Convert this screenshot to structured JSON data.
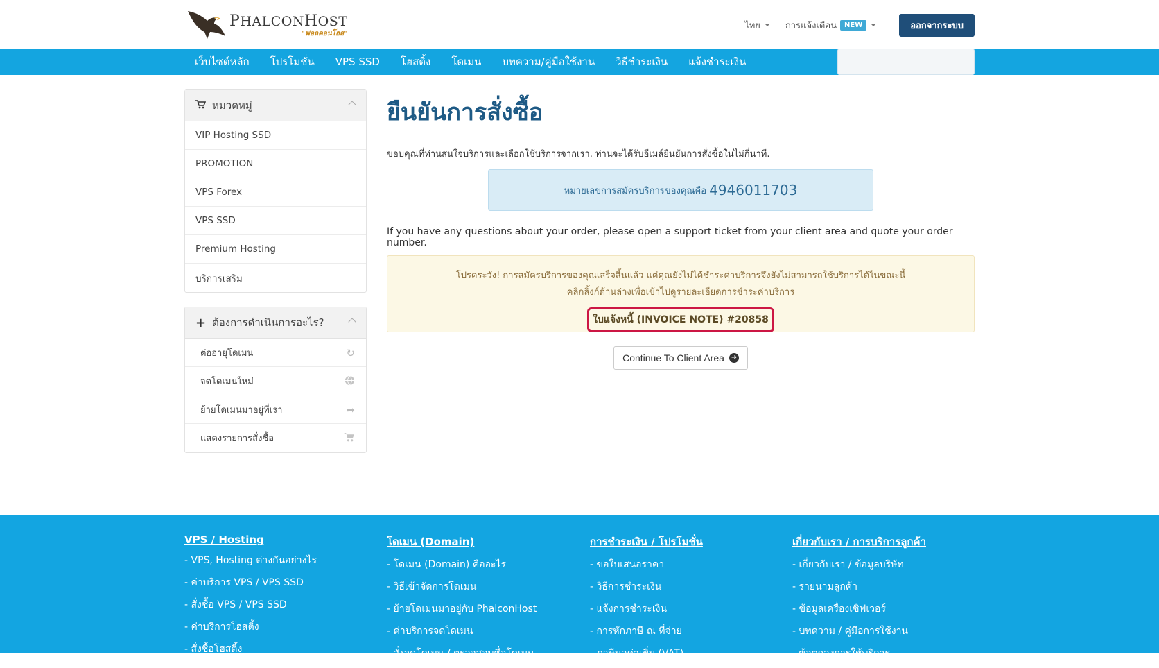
{
  "brand": {
    "name_first": "P",
    "name_rest": "HALCON",
    "name_second": "H",
    "name_second_rest": "OST",
    "tagline": "\"ฟอลคอนโฮส\""
  },
  "header": {
    "language": "ไทย",
    "notifications": "การแจ้งเตือน",
    "new_badge": "NEW",
    "logout": "ออกจากระบบ"
  },
  "nav": {
    "items": [
      "เว็บไซต์หลัก",
      "โปรโมชั่น",
      "VPS SSD",
      "โฮสติ้ง",
      "โดเมน",
      "บทความ/คู่มือใช้งาน",
      "วิธีชำระเงิน",
      "แจ้งชำระเงิน"
    ]
  },
  "sidebar": {
    "categories_title": "หมวดหมู่",
    "categories": [
      "VIP Hosting SSD",
      "PROMOTION",
      "VPS Forex",
      "VPS SSD",
      "Premium Hosting",
      "บริการเสริม"
    ],
    "actions_title": "ต้องการดำเนินการอะไร?",
    "actions": [
      {
        "label": "ต่ออายุโดเมน",
        "icon": "refresh-icon"
      },
      {
        "label": "จดโดเมนใหม่",
        "icon": "globe-icon"
      },
      {
        "label": "ย้ายโดเมนมาอยู่ที่เรา",
        "icon": "share-icon"
      },
      {
        "label": "แสดงรายการสั่งซื้อ",
        "icon": "cart-icon"
      }
    ]
  },
  "main": {
    "title": "ยืนยันการสั่งซื้อ",
    "thanks": "ขอบคุณที่ท่านสนใจบริการและเลือกใช้บริการจากเรา. ท่านจะได้รับอีเมล์ยืนยันการสั่งซื้อในไม่กี่นาที.",
    "order_label": "หมายเลขการสมัครบริการของคุณคือ",
    "order_number": "4946011703",
    "question": "If you have any questions about your order, please open a support ticket from your client area and quote your order number.",
    "alert_line1": "โปรดระวัง! การสมัครบริการของคุณเสร็จสิ้นแล้ว แต่คุณยังไม่ได้ชำระค่าบริการจึงยังไม่สามารถใช้บริการได้ในขณะนี้",
    "alert_line2": "คลิกลิ้งก์ด้านล่างเพื่อเข้าไปดูรายละเอียดการชำระค่าบริการ",
    "invoice_link": "ใบแจ้งหนี้ (INVOICE NOTE) #20858",
    "continue": "Continue To Client Area"
  },
  "footer": {
    "col1": {
      "title": "VPS / Hosting",
      "links": [
        "- VPS, Hosting ต่างกันอย่างไร",
        "- ค่าบริการ VPS / VPS SSD",
        "- สั่งซื้อ VPS / VPS SSD",
        "- ค่าบริการโฮสติ้ง",
        "- สั่งซื้อโฮสติ้ง"
      ]
    },
    "col2": {
      "title": "โดเมน (Domain)",
      "links": [
        "- โดเมน (Domain) คืออะไร",
        "- วิธีเข้าจัดการโดเมน",
        "- ย้ายโดเมนมาอยู่กับ PhalconHost",
        "- ค่าบริการจดโดเมน",
        "- สั่งจดโดเมน / ตรวจสอบชื่อโดเมน"
      ]
    },
    "col3": {
      "title": "การชำระเงิน / โปรโมชั่น",
      "links": [
        "- ขอใบเสนอราคา",
        "- วิธีการชำระเงิน",
        "- แจ้งการชำระเงิน",
        "- การหักภาษี ณ ที่จ่าย",
        "- ภาษีมูลค่าเพิ่ม (VAT)"
      ]
    },
    "col4": {
      "title": "เกี่ยวกับเรา / การบริการลูกค้า",
      "links": [
        "- เกี่ยวกับเรา / ข้อมูลบริษัท",
        "- รายนามลูกค้า",
        "- ข้อมูลเครื่องเซิฟเวอร์",
        "- บทความ / คู่มือการใช้งาน",
        "- ข้อตกลงการใช้บริการ"
      ]
    }
  },
  "colors": {
    "nav_blue": "#14a5e0",
    "title_blue": "#1e5a85",
    "logout_navy": "#1f4e79",
    "invoice_highlight": "#cc1744"
  }
}
